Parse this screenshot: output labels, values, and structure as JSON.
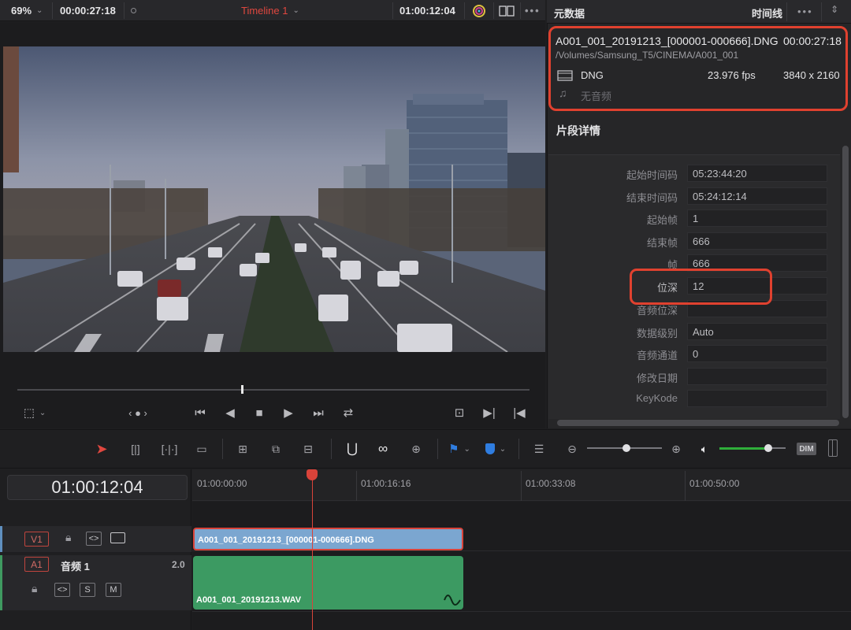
{
  "viewer_top": {
    "zoom": "69%",
    "source_timecode": "00:00:27:18",
    "timeline_name": "Timeline 1",
    "record_timecode": "01:00:12:04"
  },
  "inspector": {
    "tab_metadata": "元数据",
    "tab_timeline": "时间线",
    "clip_name": "A001_001_20191213_[000001-000666].DNG",
    "clip_duration": "00:00:27:18",
    "clip_path": "/Volumes/Samsung_T5/CINEMA/A001_001",
    "codec": "DNG",
    "fps": "23.976 fps",
    "resolution": "3840 x 2160",
    "audio": "无音频",
    "section_title": "片段详情",
    "fields": [
      {
        "label": "起始时间码",
        "value": "05:23:44:20"
      },
      {
        "label": "结束时间码",
        "value": "05:24:12:14"
      },
      {
        "label": "起始帧",
        "value": "1"
      },
      {
        "label": "结束帧",
        "value": "666"
      },
      {
        "label": "帧",
        "value": "666"
      },
      {
        "label": "位深",
        "value": "12"
      },
      {
        "label": "音频位深",
        "value": ""
      },
      {
        "label": "数据级别",
        "value": "Auto"
      },
      {
        "label": "音频通道",
        "value": "0"
      },
      {
        "label": "修改日期",
        "value": ""
      },
      {
        "label": "KeyKode",
        "value": ""
      }
    ]
  },
  "toolbar": {
    "dim_label": "DIM"
  },
  "timeline": {
    "timecode": "01:00:12:04",
    "ruler_ticks": [
      "01:00:00:00",
      "01:00:16:16",
      "01:00:33:08",
      "01:00:50:00"
    ],
    "v1_label": "V1",
    "a1_label": "A1",
    "a1_name": "音频 1",
    "a1_channels": "2.0",
    "solo_label": "S",
    "mute_label": "M",
    "video_clip_name": "A001_001_20191213_[000001-000666].DNG",
    "audio_clip_name": "A001_001_20191213.WAV"
  },
  "colors": {
    "accent_red": "#e0412f",
    "video_clip": "#7ba6d0",
    "audio_clip": "#3c9a62",
    "volume_green": "#2fae3a"
  }
}
